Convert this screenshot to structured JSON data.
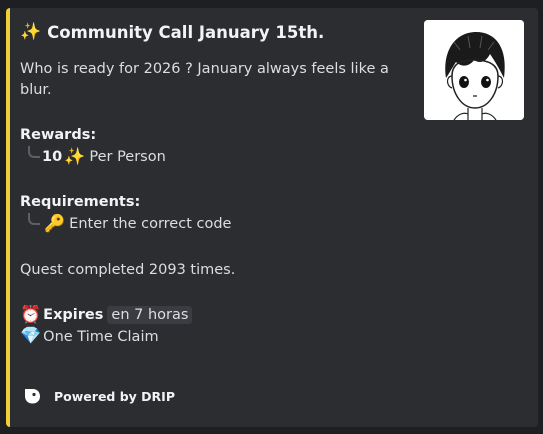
{
  "quest": {
    "title_emoji": "✨",
    "title": "Community Call January 15th.",
    "description": "Who is ready for 2026 ? January always feels like a blur.",
    "rewards_label": "Rewards:",
    "reward_amount": "10",
    "reward_emoji": "✨",
    "reward_unit": "Per Person",
    "requirements_label": "Requirements:",
    "requirement_emoji": "🔑",
    "requirement_text": "Enter the correct code",
    "completed_text": "Quest completed 2093 times.",
    "expires_emoji": "⏰",
    "expires_label": "Expires",
    "expires_value": "en 7 horas",
    "claim_emoji": "💎",
    "claim_text": "One Time Claim"
  },
  "footer": {
    "text": "Powered by DRIP"
  },
  "colors": {
    "accent_bar": "#f0d03a",
    "embed_bg": "#2b2d31",
    "page_bg": "#1e1f22"
  }
}
